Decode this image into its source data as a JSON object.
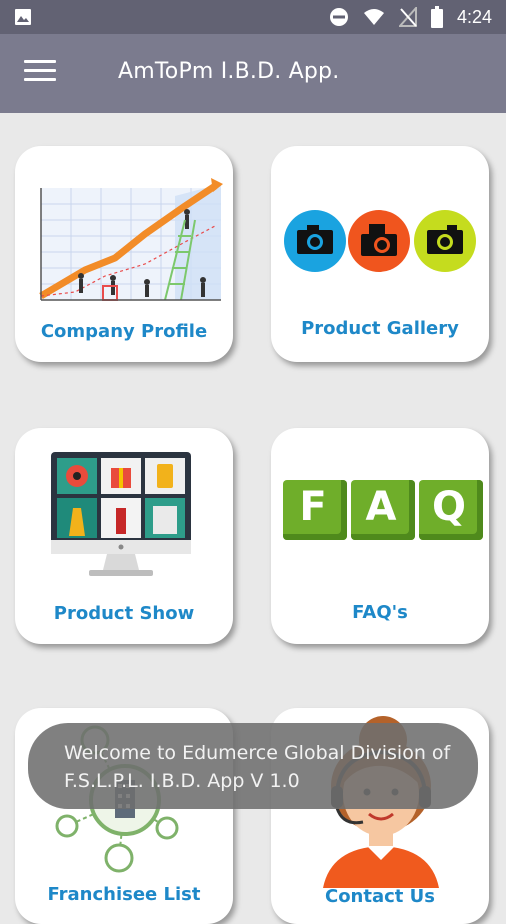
{
  "status_bar": {
    "time": "4:24",
    "icons": [
      "image-icon",
      "do-not-disturb-icon",
      "wifi-icon",
      "no-signal-icon",
      "battery-icon"
    ]
  },
  "app_bar": {
    "title": "AmToPm I.B.D. App.",
    "menu_icon": "hamburger-menu-icon",
    "background": "#7b7b8e"
  },
  "cards": [
    {
      "label": "Company Profile",
      "icon": "growth-chart-illustration"
    },
    {
      "label": "Product Gallery",
      "icon": "camera-icons"
    },
    {
      "label": "Product Show",
      "icon": "monitor-products-illustration"
    },
    {
      "label": "FAQ's",
      "icon": "faq-blocks-illustration"
    },
    {
      "label": "Franchisee List",
      "icon": "network-buildings-illustration"
    },
    {
      "label": "Contact Us",
      "icon": "support-agent-illustration"
    }
  ],
  "faq_letters": [
    "F",
    "A",
    "Q"
  ],
  "toast": {
    "message": "Welcome to Edumerce Global Division of F.S.L.P.L. I.B.D. App V 1.0"
  },
  "colors": {
    "label": "#1e88c8",
    "status_bar": "#626273",
    "background": "#e9e9e9",
    "camera_blue": "#1aa3e0",
    "camera_orange": "#f0551e",
    "camera_green": "#c5dc1e",
    "faq_green": "#6fae2a"
  }
}
